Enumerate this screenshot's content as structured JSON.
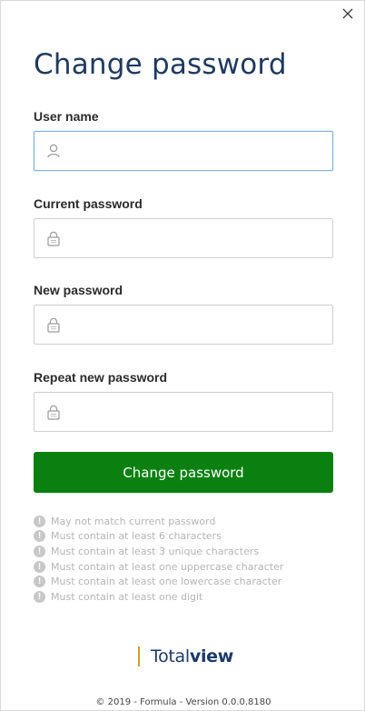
{
  "dialog": {
    "title": "Change password",
    "close_icon": "close-icon"
  },
  "fields": [
    {
      "label": "User name",
      "icon": "user-icon",
      "value": "",
      "placeholder": ""
    },
    {
      "label": "Current password",
      "icon": "lock-icon",
      "value": "",
      "placeholder": ""
    },
    {
      "label": "New password",
      "icon": "lock-icon",
      "value": "",
      "placeholder": ""
    },
    {
      "label": "Repeat new password",
      "icon": "lock-icon",
      "value": "",
      "placeholder": ""
    }
  ],
  "submit_label": "Change password",
  "rules": [
    "May not match current password",
    "Must contain at least 6 characters",
    "Must contain at least 3 unique characters",
    "Must contain at least one uppercase character",
    "Must contain at least one lowercase character",
    "Must contain at least one digit"
  ],
  "rule_icon": "exclamation-icon",
  "brand": {
    "light": "Total",
    "bold": "view"
  },
  "footer": "© 2019 - Formula - Version 0.0.0.8180",
  "colors": {
    "accent": "#0a8010",
    "title": "#1f3a5f",
    "brand": "#1c3a68",
    "brand_bar": "#c9a227"
  }
}
